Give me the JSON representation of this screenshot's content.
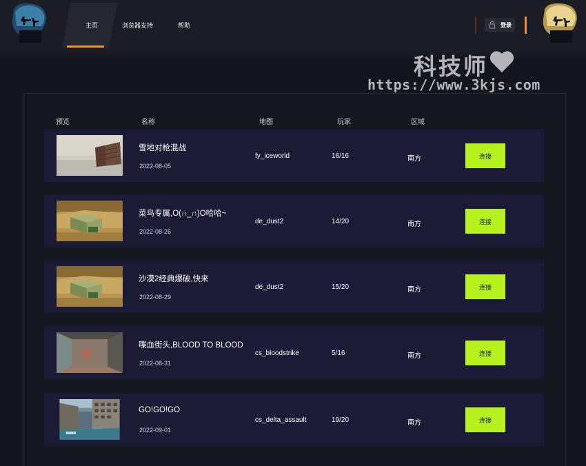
{
  "nav": {
    "items": [
      {
        "label": "主页",
        "active": true
      },
      {
        "label": "浏览器支持",
        "active": false
      },
      {
        "label": "帮助",
        "active": false
      }
    ],
    "login_label": "登录",
    "accent_color": "#f0902a"
  },
  "watermark": {
    "title": "科技师",
    "url": "https://www.3kjs.com"
  },
  "table": {
    "headers": {
      "preview": "预览",
      "name": "名称",
      "map": "地图",
      "players": "玩家",
      "region": "区域"
    },
    "connect_label": "连接",
    "connect_color": "#b6f21d",
    "rows": [
      {
        "thumb": "snow-map-thumbnail",
        "name": "雪地对枪混战",
        "date": "2022-08-05",
        "map": "fy_iceworld",
        "players": "16/16",
        "region": "南方",
        "connect": "连接"
      },
      {
        "thumb": "dust-map-thumbnail",
        "name": "菜鸟专属,O(∩_∩)O哈哈~",
        "date": "2022-08-26",
        "map": "de_dust2",
        "players": "14/20",
        "region": "南方",
        "connect": "连接"
      },
      {
        "thumb": "dust-map-thumbnail",
        "name": "沙漠2经典爆破,快来",
        "date": "2022-08-29",
        "map": "de_dust2",
        "players": "15/20",
        "region": "南方",
        "connect": "连接"
      },
      {
        "thumb": "bloodstrike-map-thumbnail",
        "name": "喋血街头,BLOOD TO BLOOD",
        "date": "2022-08-31",
        "map": "cs_bloodstrike",
        "players": "5/16",
        "region": "南方",
        "connect": "连接"
      },
      {
        "thumb": "delta-assault-map-thumbnail",
        "name": "GO!GO!GO",
        "date": "2022-09-01",
        "map": "cs_delta_assault",
        "players": "19/20",
        "region": "南方",
        "connect": "连接"
      }
    ]
  }
}
